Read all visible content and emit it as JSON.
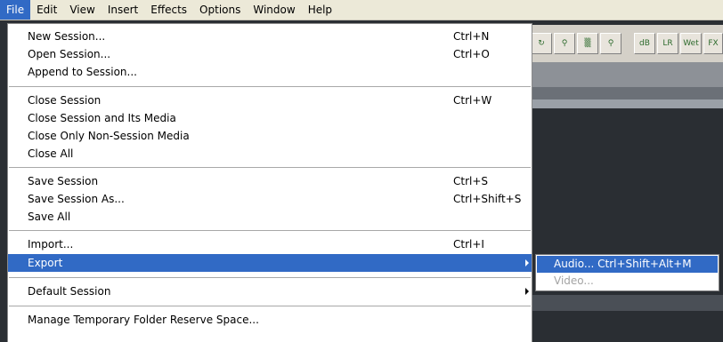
{
  "menubar": {
    "items": [
      "File",
      "Edit",
      "View",
      "Insert",
      "Effects",
      "Options",
      "Window",
      "Help"
    ]
  },
  "toolbar": {
    "wet_label": "Wet",
    "fx_label": "FX"
  },
  "file_menu": {
    "new_session": {
      "label": "New Session...",
      "shortcut": "Ctrl+N"
    },
    "open_session": {
      "label": "Open Session...",
      "shortcut": "Ctrl+O"
    },
    "append_session": {
      "label": "Append to Session..."
    },
    "close_session": {
      "label": "Close Session",
      "shortcut": "Ctrl+W"
    },
    "close_session_media": {
      "label": "Close Session and Its Media"
    },
    "close_non_session_media": {
      "label": "Close Only Non-Session Media"
    },
    "close_all": {
      "label": "Close All"
    },
    "save_session": {
      "label": "Save Session",
      "shortcut": "Ctrl+S"
    },
    "save_session_as": {
      "label": "Save Session As...",
      "shortcut": "Ctrl+Shift+S"
    },
    "save_all": {
      "label": "Save All"
    },
    "import": {
      "label": "Import...",
      "shortcut": "Ctrl+I"
    },
    "export": {
      "label": "Export"
    },
    "default_session": {
      "label": "Default Session"
    },
    "manage_temp": {
      "label": "Manage Temporary Folder Reserve Space..."
    }
  },
  "export_submenu": {
    "audio": {
      "label": "Audio...  Ctrl+Shift+Alt+M"
    },
    "video": {
      "label": "Video..."
    }
  }
}
